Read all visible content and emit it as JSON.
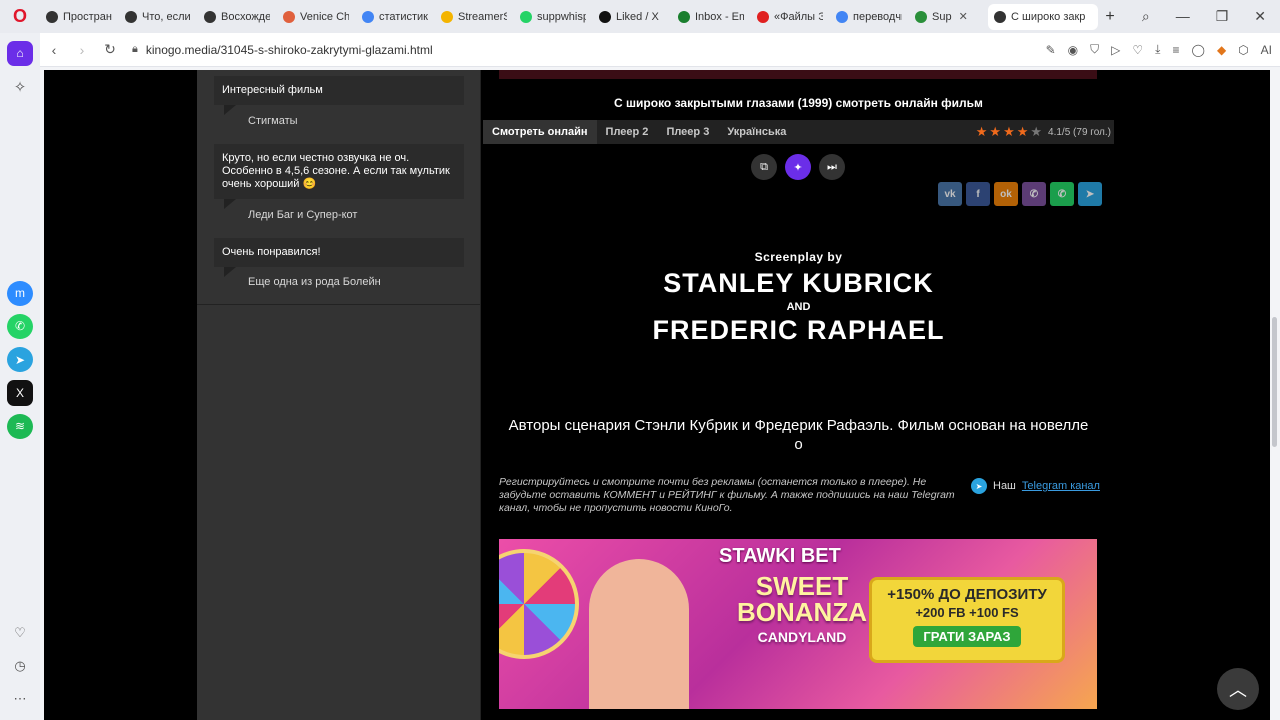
{
  "browser": {
    "tabs": [
      {
        "label": "Пространст",
        "color": "#333333"
      },
      {
        "label": "Что, если...",
        "color": "#333333"
      },
      {
        "label": "Восхожден",
        "color": "#333333"
      },
      {
        "label": "Venice Chat",
        "color": "#e0603d"
      },
      {
        "label": "статистика",
        "color": "#4285f4"
      },
      {
        "label": "StreamerSta",
        "color": "#f4b400"
      },
      {
        "label": "suppwhispe",
        "color": "#25d366"
      },
      {
        "label": "Liked / X",
        "color": "#111111"
      },
      {
        "label": "Inbox - Ema",
        "color": "#1a7f2e"
      },
      {
        "label": "«Файлы Эп",
        "color": "#e02020"
      },
      {
        "label": "переводчи",
        "color": "#4285f4"
      },
      {
        "label": "Sup",
        "color": "#2a8f3a"
      },
      {
        "label": "С широко закр",
        "color": "#333333",
        "active": true
      }
    ],
    "url": "kinogo.media/31045-s-shiroko-zakrytymi-glazami.html",
    "ai_label": "AI"
  },
  "comments": [
    {
      "text": "Интересный фильм",
      "film": "Стигматы"
    },
    {
      "text": "Круто, но если честно озвучка не оч. Особенно в 4,5,6 сезоне. А если так мультик очень хороший 😊",
      "film": "Леди Баг и Супер-кот"
    },
    {
      "text": "Очень понравился!",
      "film": "Еще одна из рода Болейн"
    }
  ],
  "film": {
    "title": "С широко закрытыми глазами (1999) смотреть онлайн фильм",
    "player_tabs": [
      "Смотреть онлайн",
      "Плеер 2",
      "Плеер 3",
      "Українська"
    ],
    "rating": "4.1/5 (79 гол.)",
    "stars_filled": 4,
    "share": [
      "vk",
      "facebook",
      "ok",
      "viber",
      "whatsapp",
      "telegram"
    ],
    "credits": {
      "line1": "Screenplay by",
      "line2": "STANLEY KUBRICK",
      "line3": "AND",
      "line4": "FREDERIC RAPHAEL"
    },
    "subtitle": "Авторы сценария Стэнли Кубрик и Фредерик Рафаэль. Фильм основан на новелле о",
    "notice": "Регистрируйтесь и смотрите почти без рекламы (останется только в плеере). Не забудьте оставить КОММЕНТ и РЕЙТИНГ к фильму. А также подпишись на наш Telegram канал, чтобы не пропустить новости КиноГо.",
    "tg_prefix": "Наш",
    "tg_link": "Telegram канал"
  },
  "banner": {
    "logo": "STAWKI BET",
    "game1": "SWEET",
    "game2": "BONANZA",
    "game3": "CANDYLAND",
    "offer1": "+150% ДО ДЕПОЗИТУ",
    "offer2": "+200 FB +100 FS",
    "cta": "ГРАТИ ЗАРАЗ"
  }
}
